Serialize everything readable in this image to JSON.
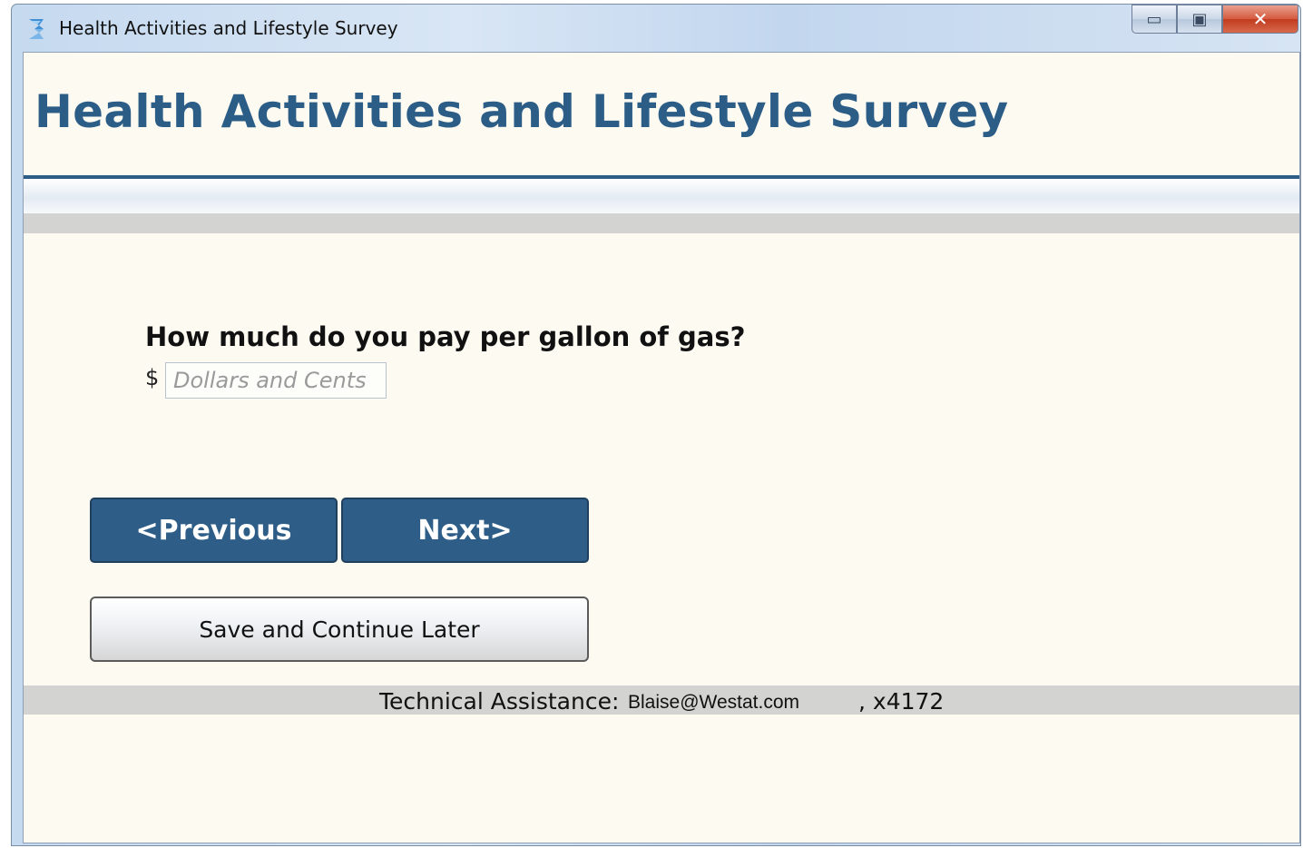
{
  "window": {
    "title": "Health Activities and Lifestyle Survey",
    "controls": {
      "minimize": "▭",
      "maximize": "▣",
      "close": "✕"
    }
  },
  "header": {
    "title": "Health Activities and Lifestyle Survey"
  },
  "question": {
    "text": "How much do you pay per gallon of gas?",
    "currency_symbol": "$",
    "input": {
      "value": "",
      "placeholder": "Dollars and Cents"
    }
  },
  "navigation": {
    "previous_label": "<Previous",
    "next_label": "Next>"
  },
  "save": {
    "label": "Save and Continue Later"
  },
  "footer": {
    "label": "Technical Assistance:",
    "email": "Blaise@Westat.com",
    "extension": ", x4172"
  },
  "colors": {
    "accent": "#2b5d87",
    "button_primary": "#2e5e88",
    "background": "#fdfaf2",
    "band_grey": "#d3d3d2"
  },
  "icons": {
    "app": "app-icon",
    "minimize": "minimize-icon",
    "maximize": "maximize-icon",
    "close": "close-icon"
  }
}
